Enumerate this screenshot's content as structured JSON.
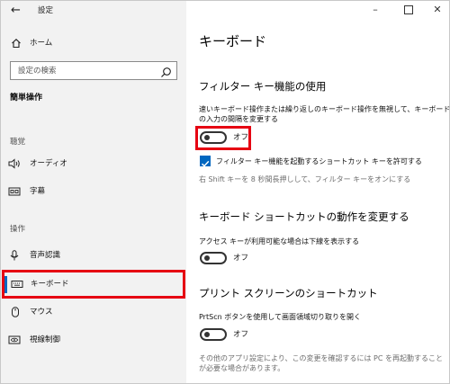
{
  "window": {
    "title": "設定",
    "back_icon": "back-arrow-icon",
    "controls": [
      "minimize-icon",
      "maximize-icon",
      "close-icon"
    ]
  },
  "sidebar": {
    "home": "ホーム",
    "search_placeholder": "設定の検索",
    "section": "簡単操作",
    "groups": [
      {
        "label": "聴覚",
        "items": [
          {
            "label": "オーディオ",
            "icon": "speaker-icon"
          },
          {
            "label": "字幕",
            "icon": "closed-captions-icon"
          }
        ]
      },
      {
        "label": "操作",
        "items": [
          {
            "label": "音声認識",
            "icon": "microphone-icon"
          },
          {
            "label": "キーボード",
            "icon": "keyboard-icon",
            "selected": true
          },
          {
            "label": "マウス",
            "icon": "mouse-icon"
          },
          {
            "label": "視線制御",
            "icon": "eye-control-icon"
          }
        ]
      }
    ]
  },
  "main": {
    "title": "キーボード",
    "filter_keys": {
      "heading": "フィルター キー機能の使用",
      "desc_line1": "速いキーボード操作または繰り返しのキーボード操作を無視して、キーボード",
      "desc_line2": "の入力の間隔を変更する",
      "toggle_label": "オフ",
      "toggle_on": false,
      "shortcut_checkbox_label": "フィルター キー機能を起動するショートカット キーを許可する",
      "shortcut_checked": true,
      "shortcut_hint": "右 Shift キーを 8 秒間長押しして、フィルター キーをオンにする"
    },
    "keyboard_shortcuts": {
      "heading": "キーボード ショートカットの動作を変更する",
      "desc": "アクセス キーが利用可能な場合は下線を表示する",
      "toggle_label": "オフ",
      "toggle_on": false
    },
    "print_screen": {
      "heading": "プリント スクリーンのショートカット",
      "desc": "PrtScn ボタンを使用して画面領域切り取りを開く",
      "toggle_label": "オフ",
      "toggle_on": false,
      "note_line1": "その他のアプリ設定により、この変更を確認するには PC を再起動すること",
      "note_line2": "が必要な場合があります。"
    }
  }
}
